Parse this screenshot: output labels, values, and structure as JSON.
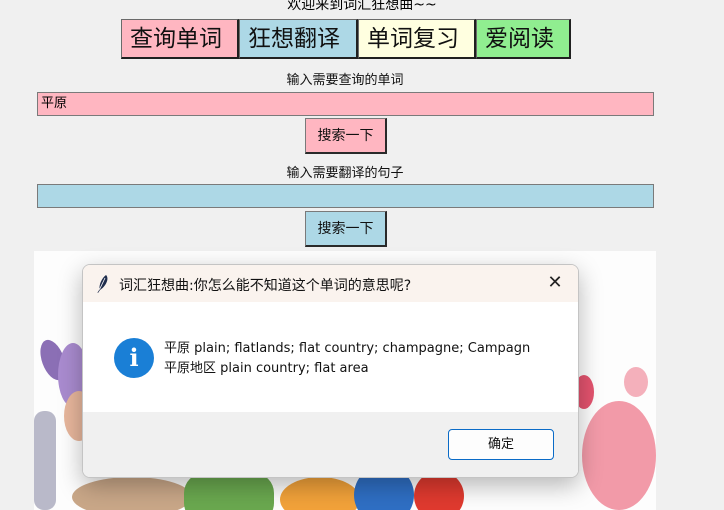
{
  "app": {
    "welcome": "欢迎来到词汇狂想曲~~"
  },
  "nav": {
    "buttons": [
      {
        "label": "查询单词"
      },
      {
        "label": "狂想翻译"
      },
      {
        "label": "单词复习"
      },
      {
        "label": "爱阅读"
      }
    ]
  },
  "lookup": {
    "label": "输入需要查询的单词",
    "value": "平原",
    "button": "搜索一下"
  },
  "translate": {
    "label": "输入需要翻译的句子",
    "value": "",
    "button": "搜索一下"
  },
  "dialog": {
    "title": "词汇狂想曲:你怎么能不知道这个单词的意思呢?",
    "close": "✕",
    "icon": "info-icon",
    "message_line1": "平原 plain; flatlands; flat country; champagne; Campagn",
    "message_line2": "平原地区 plain country; flat area",
    "ok": "确定"
  },
  "colors": {
    "pink": "#ffb6c1",
    "lightblue": "#add8e6",
    "lightyellow": "#ffffe0",
    "lightgreen": "#90ee90",
    "accent": "#1a7fd6"
  }
}
